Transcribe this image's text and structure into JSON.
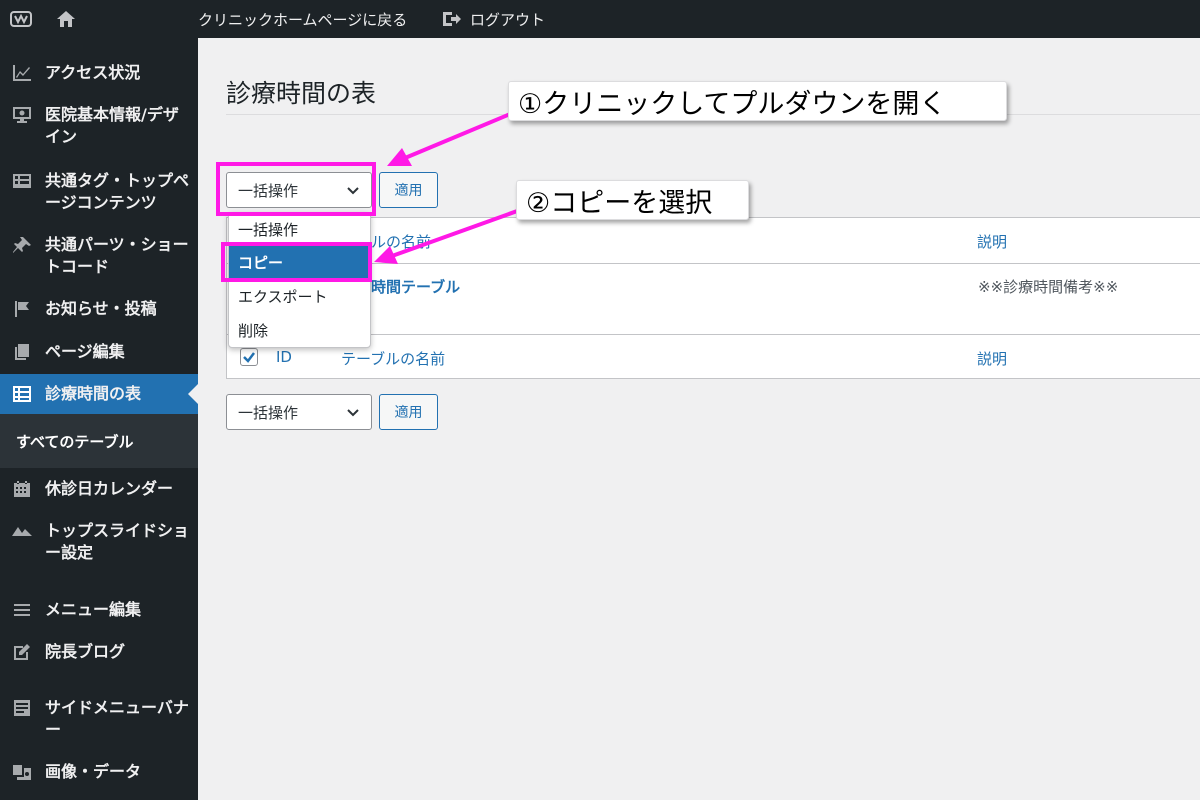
{
  "admin_bar": {
    "back_link": "クリニックホームページに戻る",
    "logout": "ログアウト"
  },
  "sidebar": {
    "items": [
      {
        "label": "アクセス状況",
        "icon": "chart-line-icon"
      },
      {
        "label": "医院基本情報/デザイン",
        "icon": "monitor-icon"
      },
      {
        "label": "共通タグ・トップページコンテンツ",
        "icon": "list-view-icon"
      },
      {
        "label": "共通パーツ・ショートコード",
        "icon": "pin-icon"
      },
      {
        "label": "お知らせ・投稿",
        "icon": "flag-icon"
      },
      {
        "label": "ページ編集",
        "icon": "pages-icon"
      },
      {
        "label": "診療時間の表",
        "icon": "table-icon",
        "current": true
      },
      {
        "label": "休診日カレンダー",
        "icon": "calendar-icon"
      },
      {
        "label": "トップスライドショー設定",
        "icon": "slides-icon"
      },
      {
        "label": "メニュー編集",
        "icon": "menu-icon"
      },
      {
        "label": "院長ブログ",
        "icon": "edit-icon"
      },
      {
        "label": "サイドメニューバナー",
        "icon": "text-page-icon"
      },
      {
        "label": "画像・データ",
        "icon": "media-icon"
      }
    ],
    "submenu": [
      "すべてのテーブル"
    ]
  },
  "main": {
    "title": "診療時間の表",
    "bulk_action_label": "一括操作",
    "apply_label": "適用",
    "dropdown_options": [
      "一括操作",
      "コピー",
      "エクスポート",
      "削除"
    ],
    "dropdown_selected": "コピー",
    "table": {
      "header_name": "テーブルの名前",
      "header_name_partial": "ブルの名前",
      "header_desc": "説明",
      "footer_id": "ID",
      "footer_name": "テーブルの名前",
      "footer_desc": "説明",
      "row_title_partial": "療時間テーブル",
      "row_desc": "※※診療時間備考※※"
    }
  },
  "annotations": {
    "step1": "①クリニックしてプルダウンを開く",
    "step2": "②コピーを選択",
    "highlight_color": "#ff19e6"
  },
  "colors": {
    "admin_bg": "#1d2327",
    "accent": "#2271b1",
    "page_bg": "#f0f0f1"
  }
}
